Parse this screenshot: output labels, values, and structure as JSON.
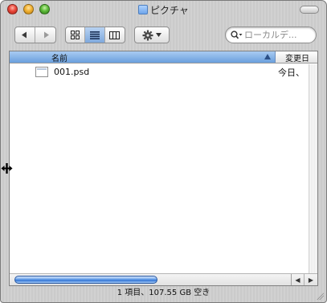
{
  "window": {
    "title": "ピクチャ"
  },
  "toolbar": {
    "back_icon": "arrow-left",
    "forward_icon": "arrow-right",
    "view_modes": [
      "icon-view",
      "list-view",
      "column-view"
    ],
    "active_view": "list-view",
    "action_icon": "gear"
  },
  "search": {
    "placeholder": "ローカルデ..."
  },
  "columns": {
    "name": "名前",
    "date": "変更日"
  },
  "files": [
    {
      "name": "001.psd",
      "date": "今日、"
    }
  ],
  "status": {
    "text": "1 項目、107.55 GB 空き"
  },
  "colors": {
    "accent": "#6a9fdd",
    "scroll_thumb": "#2f72d4"
  }
}
